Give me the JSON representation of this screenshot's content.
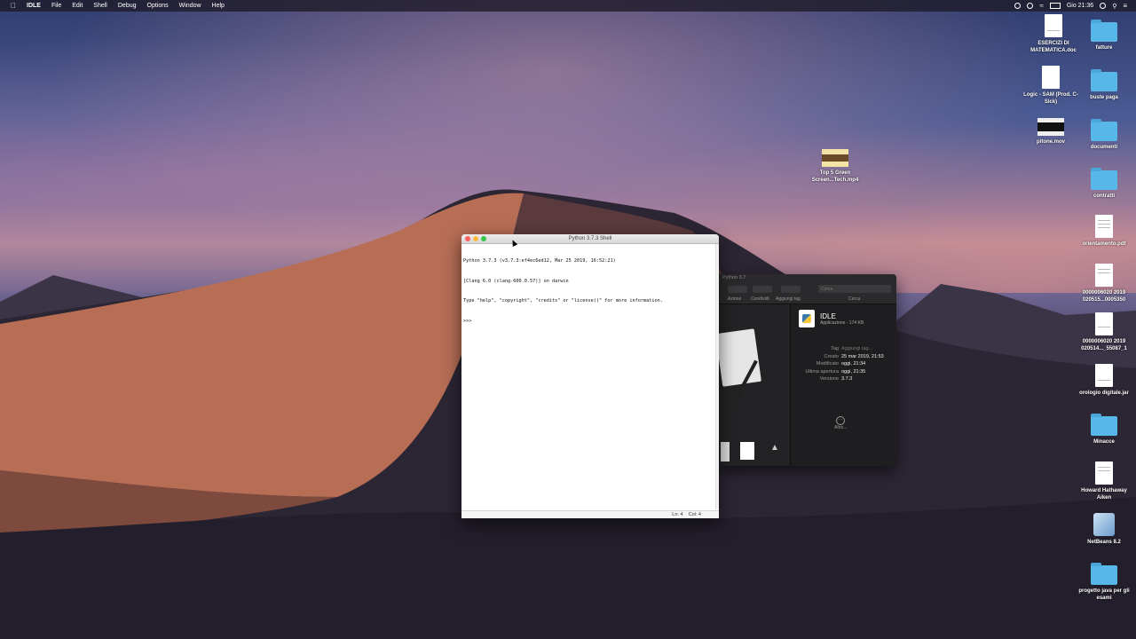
{
  "menubar": {
    "apple": "",
    "app_name": "IDLE",
    "menus": [
      "File",
      "Edit",
      "Shell",
      "Debug",
      "Options",
      "Window",
      "Help"
    ],
    "clock": "Gio 21:36"
  },
  "shell": {
    "title": "Python 3.7.3 Shell",
    "lines": [
      "Python 3.7.3 (v3.7.3:ef4ec6ed12, Mar 25 2019, 16:52:21)",
      "[Clang 6.0 (clang-600.0.57)] on darwin",
      "Type \"help\", \"copyright\", \"credits\" or \"license()\" for more information.",
      ">>> "
    ],
    "status_line": "Ln: 4",
    "status_col": "Col: 4"
  },
  "finder": {
    "window_title": "Python 3.7",
    "toolbar": {
      "action": "Azione",
      "share": "Condividi",
      "tags": "Aggiungi tag",
      "search": "Cerca",
      "search_placeholder": "Cerca"
    },
    "app_name": "IDLE",
    "app_kind": "Applicazione - 174 KB",
    "meta": [
      {
        "k": "Tag",
        "v": "Aggiungi tag..."
      },
      {
        "k": "Creato",
        "v": "25 mar 2019, 21:53"
      },
      {
        "k": "Modificato",
        "v": "oggi, 21:34"
      },
      {
        "k": "Ultima apertura",
        "v": "oggi, 21:35"
      },
      {
        "k": "Versione",
        "v": "3.7.3"
      }
    ],
    "more": "Altro..."
  },
  "desktop": {
    "icons": [
      {
        "label": "ESERCIZI DI MATEMATICA.doc",
        "type": "doc"
      },
      {
        "label": "fatture",
        "type": "folder"
      },
      {
        "label": "Logic - SAM (Prod. C-Sick)",
        "type": "doc"
      },
      {
        "label": "buste paga",
        "type": "folder"
      },
      {
        "label": "pitone.mov",
        "type": "video"
      },
      {
        "label": "documenti",
        "type": "folder"
      },
      {
        "label": "Top 5 Green Screen...Tech.mp4",
        "type": "video"
      },
      {
        "label": "contratti",
        "type": "folder"
      },
      {
        "label": "orientamento.pdf",
        "type": "doc"
      },
      {
        "label": "0000006020 2019 020515...0005350",
        "type": "doc"
      },
      {
        "label": "0000006020 2019 020514..._55087_1",
        "type": "doc"
      },
      {
        "label": "orologio digitale.jar",
        "type": "doc"
      },
      {
        "label": "Minacce",
        "type": "folder"
      },
      {
        "label": "Howard Hathaway Aiken",
        "type": "doc"
      },
      {
        "label": "NetBeans 8.2",
        "type": "app"
      },
      {
        "label": "progetto java per gli esami",
        "type": "folder"
      }
    ]
  },
  "colors": {
    "folder": "#56b7e8",
    "close": "#fc605c",
    "minimize": "#fdbc40",
    "zoom": "#34c84a"
  }
}
